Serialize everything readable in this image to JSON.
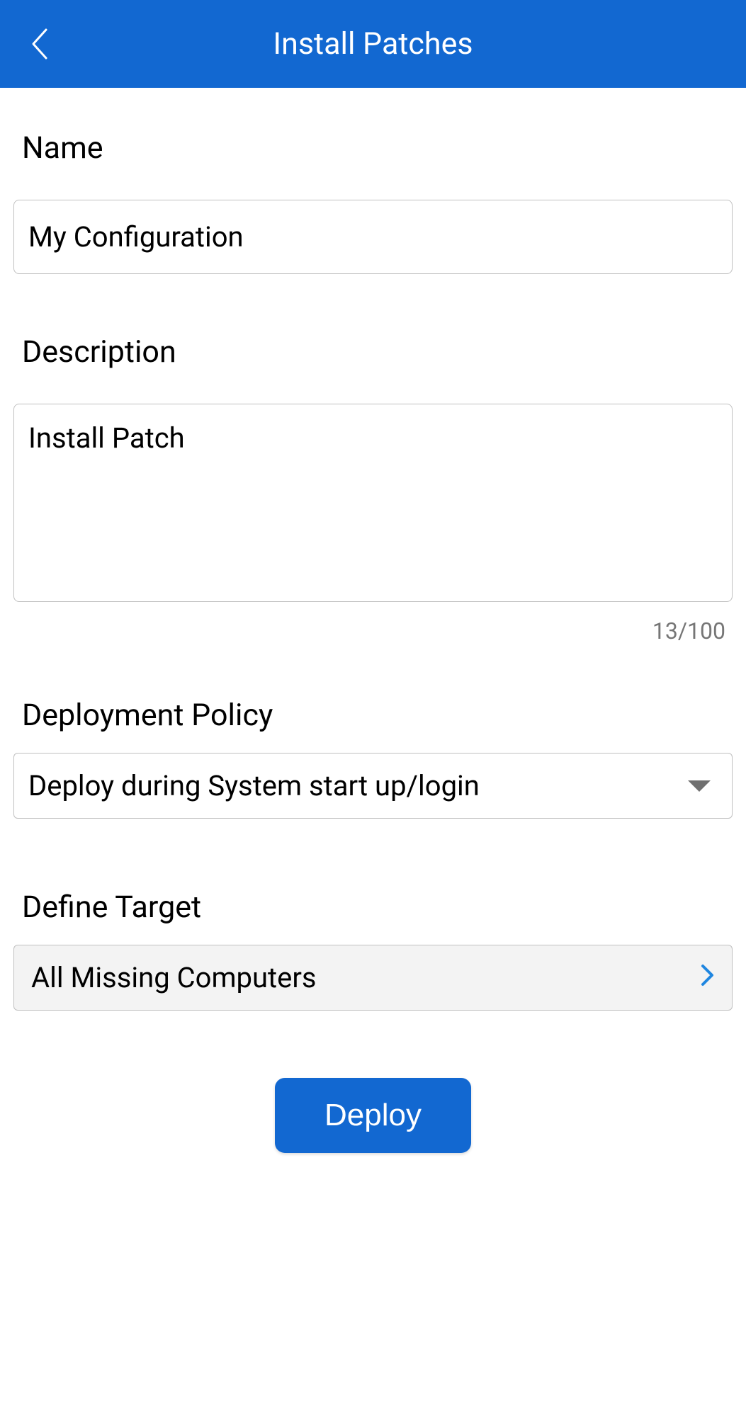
{
  "header": {
    "title": "Install Patches"
  },
  "form": {
    "name": {
      "label": "Name",
      "value": "My Configuration"
    },
    "description": {
      "label": "Description",
      "value": "Install Patch",
      "counter": "13/100"
    },
    "deploymentPolicy": {
      "label": "Deployment Policy",
      "selected": "Deploy during System start up/login"
    },
    "defineTarget": {
      "label": "Define Target",
      "value": "All Missing Computers"
    },
    "deployButton": "Deploy"
  }
}
